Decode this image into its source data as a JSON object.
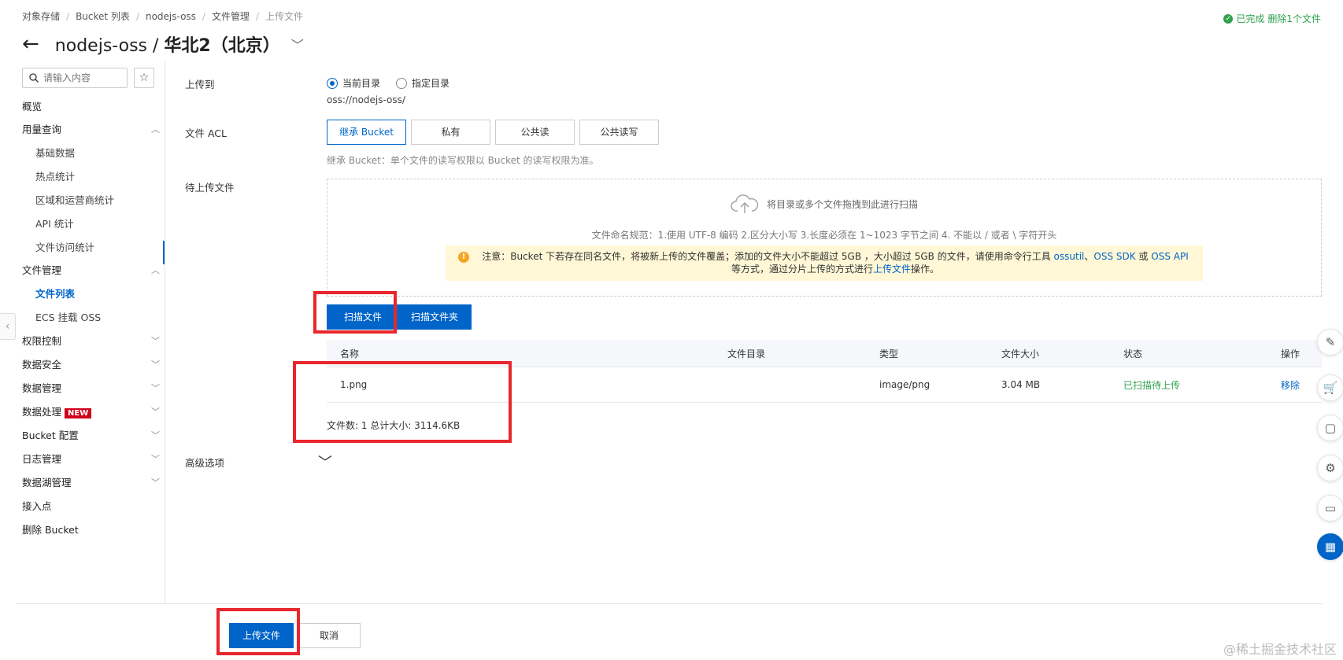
{
  "breadcrumb": [
    "对象存储",
    "Bucket 列表",
    "nodejs-oss",
    "文件管理",
    "上传文件"
  ],
  "done_notice": {
    "status": "已完成",
    "action": "删除1个文件"
  },
  "header": {
    "bucket": "nodejs-oss",
    "separator": " / ",
    "region": "华北2（北京）"
  },
  "sidebar": {
    "search_placeholder": "请输入内容",
    "items": [
      {
        "label": "概览"
      },
      {
        "label": "用量查询"
      },
      {
        "label": "基础数据"
      },
      {
        "label": "热点统计"
      },
      {
        "label": "区域和运营商统计"
      },
      {
        "label": "API 统计"
      },
      {
        "label": "文件访问统计"
      },
      {
        "label": "文件管理"
      },
      {
        "label": "文件列表"
      },
      {
        "label": "ECS 挂载 OSS"
      },
      {
        "label": "权限控制"
      },
      {
        "label": "数据安全"
      },
      {
        "label": "数据管理"
      },
      {
        "label": "数据处理",
        "badge": "NEW"
      },
      {
        "label": "Bucket 配置"
      },
      {
        "label": "日志管理"
      },
      {
        "label": "数据湖管理"
      },
      {
        "label": "接入点"
      },
      {
        "label": "删除 Bucket"
      }
    ]
  },
  "form": {
    "upload_to_label": "上传到",
    "radio_current": "当前目录",
    "radio_specified": "指定目录",
    "oss_path": "oss://nodejs-oss/",
    "acl_label": "文件 ACL",
    "acl_options": [
      "继承 Bucket",
      "私有",
      "公共读",
      "公共读写"
    ],
    "acl_selected": "继承 Bucket",
    "acl_hint": "继承 Bucket：单个文件的读写权限以 Bucket 的读写权限为准。",
    "pending_label": "待上传文件",
    "drop_text": "将目录或多个文件拖拽到此进行扫描",
    "naming_rule": "文件命名规范：1.使用 UTF-8 编码 2.区分大小写 3.长度必须在 1~1023 字节之间 4. 不能以 / 或者 \\ 字符开头",
    "notice_prefix": "注意：Bucket 下若存在同名文件，将被新上传的文件覆盖；添加的文件大小不能超过 5GB ，大小超过 5GB 的文件，请使用命令行工具 ",
    "notice_link1": "ossutil",
    "notice_sep1": "、",
    "notice_link2": "OSS SDK",
    "notice_or": " 或 ",
    "notice_link3": "OSS API",
    "notice_mid": " 等方式，通过分片上传的方式进行",
    "notice_link4": "上传文件",
    "notice_suffix": "操作。",
    "scan_file": "扫描文件",
    "scan_folder": "扫描文件夹",
    "advanced_label": "高级选项"
  },
  "table": {
    "columns": [
      "名称",
      "文件目录",
      "类型",
      "文件大小",
      "状态",
      "操作"
    ],
    "rows": [
      {
        "name": "1.png",
        "dir": "",
        "type": "image/png",
        "size": "3.04 MB",
        "status": "已扫描待上传",
        "action": "移除"
      }
    ],
    "summary": "文件数: 1   总计大小: 3114.6KB"
  },
  "footer": {
    "upload": "上传文件",
    "cancel": "取消"
  },
  "watermark": "@稀土掘金技术社区",
  "colors": {
    "primary": "#0064c8",
    "success": "#30a14e",
    "annotation": "#e8262c",
    "notice_bg": "#fff7d6"
  }
}
